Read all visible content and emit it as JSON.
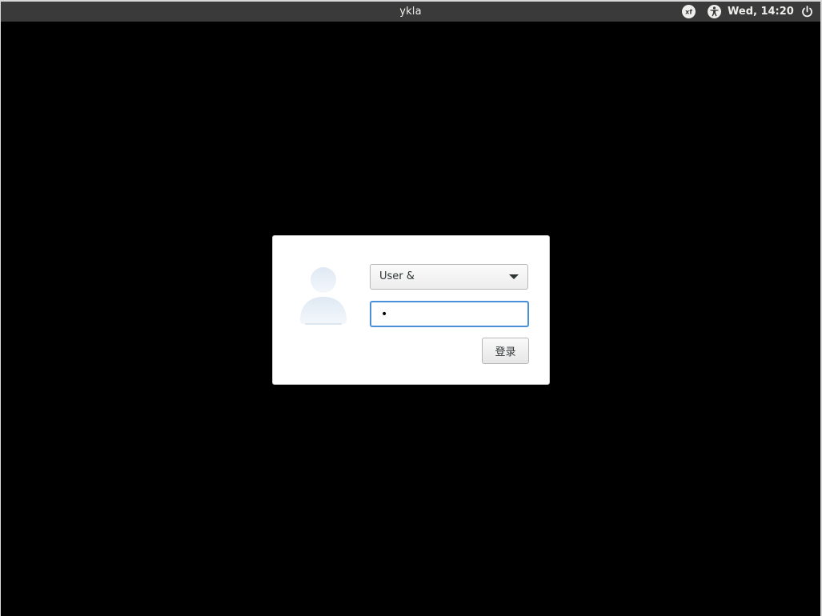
{
  "top_bar": {
    "hostname": "ykla",
    "clock": "Wed, 14:20",
    "icons": {
      "keyboard": "keyboard-layout-icon",
      "accessibility": "accessibility-icon",
      "power": "power-icon"
    },
    "keyboard_layout_label": "xf"
  },
  "login_dialog": {
    "avatar_icon": "user-avatar-icon",
    "user_select": {
      "selected_value": "User &"
    },
    "password": {
      "value": "•"
    },
    "login_button_label": "登录"
  },
  "colors": {
    "top_bar_bg": "#3a3a3a",
    "screen_bg": "#000000",
    "dialog_bg": "#ffffff",
    "focus_accent": "#4a90d9"
  }
}
